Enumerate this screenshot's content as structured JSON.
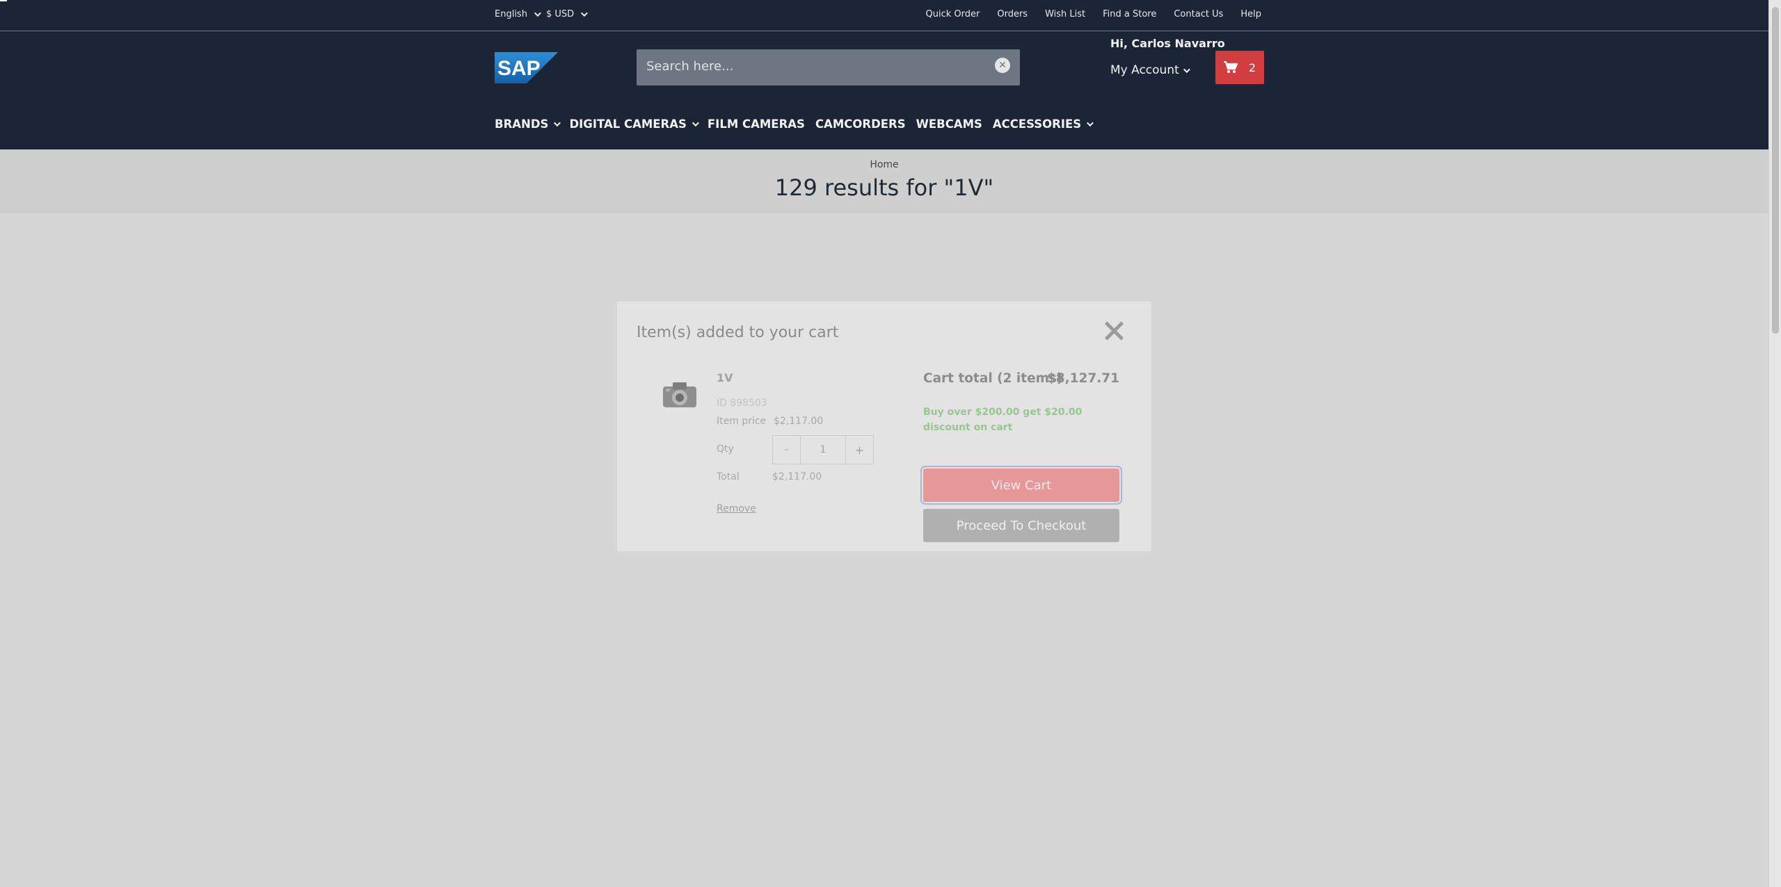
{
  "topbar": {
    "language": "English",
    "currency": "$ USD",
    "links": [
      "Quick Order",
      "Orders",
      "Wish List",
      "Find a Store",
      "Contact Us",
      "Help"
    ]
  },
  "header": {
    "logo_text": "SAP",
    "search_placeholder": "Search here...",
    "greeting": "Hi, Carlos Navarro",
    "account_label": "My Account",
    "cart_count": "2",
    "nav": [
      "BRANDS",
      "DIGITAL CAMERAS",
      "FILM CAMERAS",
      "CAMCORDERS",
      "WEBCAMS",
      "ACCESSORIES"
    ]
  },
  "page": {
    "breadcrumb": "Home",
    "results_title": "129 results for \"1V\""
  },
  "modal": {
    "title": "Item(s) added to your cart",
    "product": {
      "name": "1V",
      "id": "ID 898503",
      "item_price_label": "Item price",
      "item_price": "$2,117.00",
      "qty_label": "Qty",
      "qty_minus": "-",
      "qty_value": "1",
      "qty_plus": "+",
      "total_label": "Total",
      "total": "$2,117.00",
      "remove_label": "Remove"
    },
    "cart_total_label": "Cart total (2 items)",
    "cart_total_value": "$8,127.71",
    "promo": "Buy over $200.00 get $20.00 discount on cart",
    "view_cart_label": "View Cart",
    "checkout_label": "Proceed To Checkout"
  },
  "colors": {
    "header_bg": "#1c2536",
    "cart_red": "#d43d3f",
    "promo_green": "#98c690",
    "modal_bg": "#e3e3e3"
  }
}
